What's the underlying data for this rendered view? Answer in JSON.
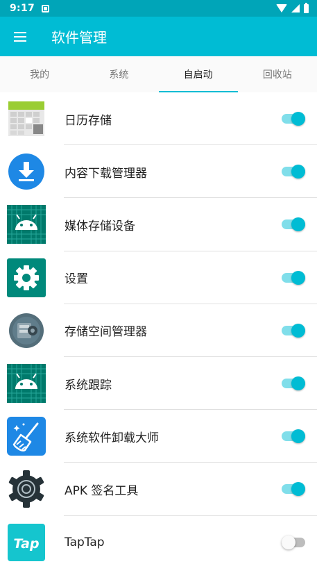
{
  "status_bar": {
    "time": "9:17"
  },
  "app_bar": {
    "title": "软件管理"
  },
  "tabs": [
    {
      "label": "我的",
      "active": false
    },
    {
      "label": "系统",
      "active": false
    },
    {
      "label": "自启动",
      "active": true
    },
    {
      "label": "回收站",
      "active": false
    }
  ],
  "apps": [
    {
      "name": "日历存储",
      "icon": "calendar-storage-icon",
      "autostart": true
    },
    {
      "name": "内容下载管理器",
      "icon": "download-manager-icon",
      "autostart": true
    },
    {
      "name": "媒体存储设备",
      "icon": "android-icon",
      "autostart": true
    },
    {
      "name": "设置",
      "icon": "settings-gear-icon",
      "autostart": true
    },
    {
      "name": "存储空间管理器",
      "icon": "storage-manager-icon",
      "autostart": true
    },
    {
      "name": "系统跟踪",
      "icon": "android-icon",
      "autostart": true
    },
    {
      "name": "系统软件卸载大师",
      "icon": "broom-cleaner-icon",
      "autostart": true
    },
    {
      "name": "APK 签名工具",
      "icon": "gear-icon",
      "autostart": true
    },
    {
      "name": "TapTap",
      "icon": "taptap-logo-icon",
      "autostart": false
    }
  ],
  "colors": {
    "primary": "#00bcd4",
    "status_bar": "#00a5b8",
    "switch_track_on": "#80deea",
    "switch_off": "#bdbdbd"
  }
}
